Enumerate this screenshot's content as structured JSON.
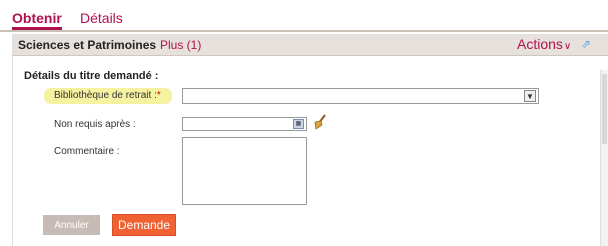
{
  "tabs": [
    {
      "label": "Obtenir"
    },
    {
      "label": "Détails"
    }
  ],
  "bar": {
    "title": "Sciences et Patrimoines",
    "plus": "Plus (1)",
    "actions": "Actions",
    "icons": [
      "chevron-down-icon",
      "popout-icon",
      "close-icon"
    ]
  },
  "form": {
    "section_title": "Détails du titre demandé :",
    "fields": {
      "pickup_library": {
        "label": "Bibliothèque de retrait :",
        "required_mark": "*",
        "value": ""
      },
      "not_needed_after": {
        "label": "Non requis après :",
        "value": ""
      },
      "comment": {
        "label": "Commentaire :",
        "value": ""
      }
    },
    "buttons": {
      "cancel": "Annuler",
      "submit": "Demande"
    }
  },
  "colors": {
    "brand": "#b0124f",
    "submit": "#f06233",
    "highlight": "#f5f2a0",
    "bar": "#e6e1dc"
  }
}
